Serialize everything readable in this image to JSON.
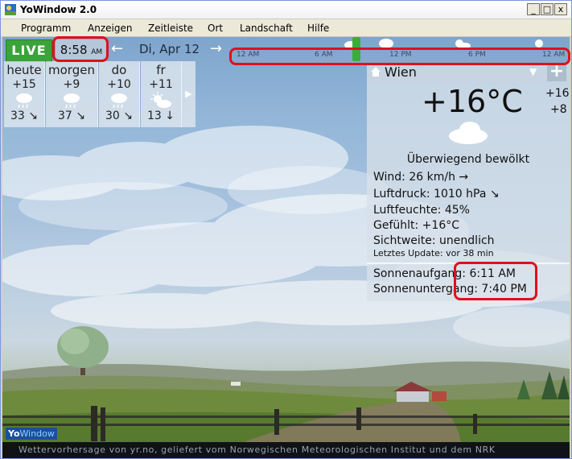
{
  "window": {
    "title": "YoWindow 2.0",
    "controls": {
      "minimize": "_",
      "maximize": "□",
      "close": "x"
    }
  },
  "menu": [
    "Programm",
    "Anzeigen",
    "Zeitleiste",
    "Ort",
    "Landschaft",
    "Hilfe"
  ],
  "topbar": {
    "live_label": "LIVE",
    "time": "8:58",
    "time_suffix": "AM",
    "prev_arrow": "←",
    "date": "Di, Apr 12",
    "next_arrow": "→"
  },
  "timeline": {
    "labels": [
      "12 AM",
      "6 AM",
      "12 PM",
      "6 PM",
      "12 AM"
    ],
    "cursor_position_fraction": 0.37
  },
  "forecast": [
    {
      "day": "heute",
      "temp": "+15",
      "icon": "rain-cloud-icon",
      "wind": "33 ↘"
    },
    {
      "day": "morgen",
      "temp": "+9",
      "icon": "rain-cloud-icon",
      "wind": "37 ↘"
    },
    {
      "day": "do",
      "temp": "+10",
      "icon": "rain-cloud-icon",
      "wind": "30 ↘"
    },
    {
      "day": "fr",
      "temp": "+11",
      "icon": "sun-cloud-icon",
      "wind": "13 ↓"
    }
  ],
  "forecast_next": "▶",
  "details": {
    "city": "Wien",
    "dropdown": "▼",
    "add": "+",
    "current_temp": "+16°C",
    "high": "+16",
    "low": "+8",
    "description": "Überwiegend bewölkt",
    "wind": "Wind:  26 km/h  →",
    "pressure": "Luftdruck:  1010 hPa  ↘",
    "humidity": "Luftfeuchte:  45%",
    "feels_like": "Gefühlt:  +16°C",
    "visibility": "Sichtweite:  unendlich",
    "updated": "Letztes Update:  vor 38 min",
    "sunrise": "Sonnenaufgang:  6:11 AM",
    "sunset": "Sonnenuntergang:  7:40 PM"
  },
  "status_text": "Wettervorhersage von yr.no, geliefert vom Norwegischen Meteorologischen Institut und dem NRK",
  "logo": {
    "yo": "Yo",
    "window": "Window"
  },
  "colors": {
    "live": "#3aa33a",
    "highlight": "#e0101a",
    "status_bg": "#0f1216"
  }
}
